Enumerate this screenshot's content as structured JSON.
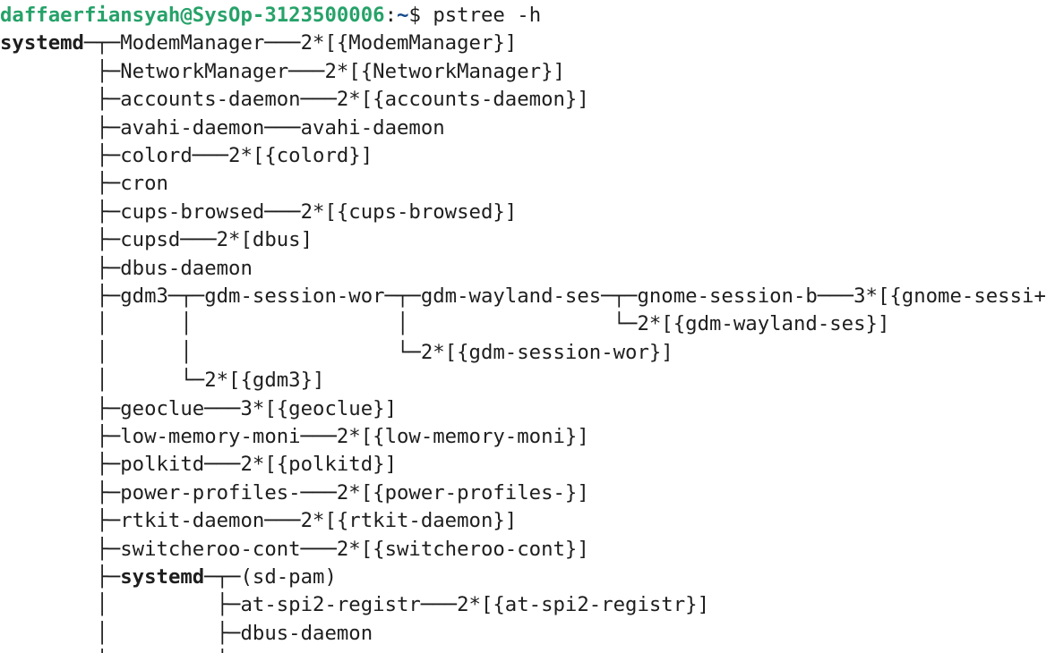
{
  "terminal": {
    "prompt": {
      "user_host": "daffaerfiansyah@SysOp-3123500006",
      "path_separator": ":",
      "path": "~",
      "symbol": "$ ",
      "command": "pstree -h"
    },
    "colors": {
      "background": "#ffffff",
      "text": "#1e1e1e",
      "user_host": "#26a269",
      "path": "#12488b"
    },
    "output": [
      "systemd─┬─ModemManager───2*[{ModemManager}]",
      "        ├─NetworkManager───2*[{NetworkManager}]",
      "        ├─accounts-daemon───2*[{accounts-daemon}]",
      "        ├─avahi-daemon───avahi-daemon",
      "        ├─colord───2*[{colord}]",
      "        ├─cron",
      "        ├─cups-browsed───2*[{cups-browsed}]",
      "        ├─cupsd───2*[dbus]",
      "        ├─dbus-daemon",
      "        ├─gdm3─┬─gdm-session-wor─┬─gdm-wayland-ses─┬─gnome-session-b───3*[{gnome-sessi+",
      "        │      │                 │                 └─2*[{gdm-wayland-ses}]",
      "        │      │                 └─2*[{gdm-session-wor}]",
      "        │      └─2*[{gdm3}]",
      "        ├─geoclue───3*[{geoclue}]",
      "        ├─low-memory-moni───2*[{low-memory-moni}]",
      "        ├─polkitd───2*[{polkitd}]",
      "        ├─power-profiles-───2*[{power-profiles-}]",
      "        ├─rtkit-daemon───2*[{rtkit-daemon}]",
      "        ├─switcheroo-cont───2*[{switcheroo-cont}]",
      "        ├─systemd─┬─(sd-pam)",
      "        │         ├─at-spi2-registr───2*[{at-spi2-registr}]",
      "        │         ├─dbus-daemon",
      "        │         │"
    ]
  }
}
